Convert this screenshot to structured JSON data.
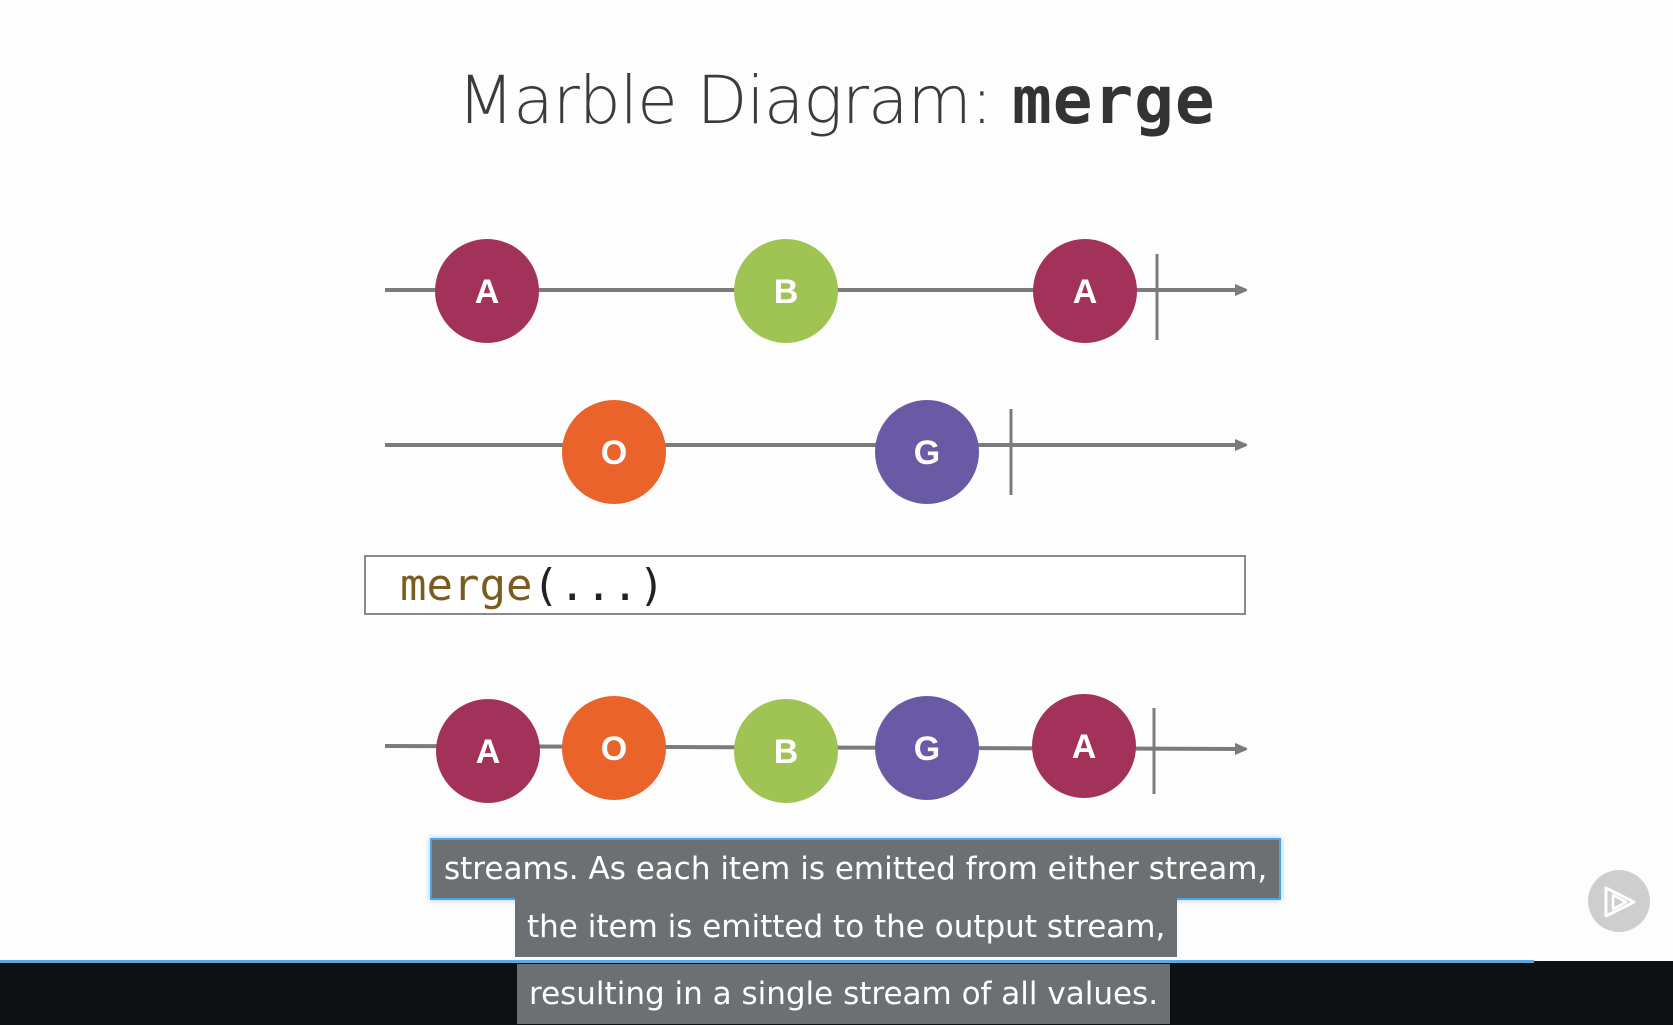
{
  "slide": {
    "title_text": "Marble Diagram: ",
    "title_code": "merge",
    "operator_fn": "merge",
    "operator_args": "(...)"
  },
  "diagram": {
    "colors": {
      "A": "#a3325b",
      "B": "#a0c453",
      "O": "#e9632b",
      "G": "#6a5aa6",
      "line": "#7b7b7b"
    },
    "input_stream_1": [
      "A",
      "B",
      "A"
    ],
    "input_stream_2": [
      "O",
      "G"
    ],
    "output_stream": [
      "A",
      "O",
      "B",
      "G",
      "A"
    ]
  },
  "captions": [
    "streams. As each item is emitted from either stream,",
    "the item is emitted to the output stream,",
    "resulting in a single stream of all values."
  ],
  "player": {
    "play_icon": "play-icon",
    "progress": 0.917
  }
}
